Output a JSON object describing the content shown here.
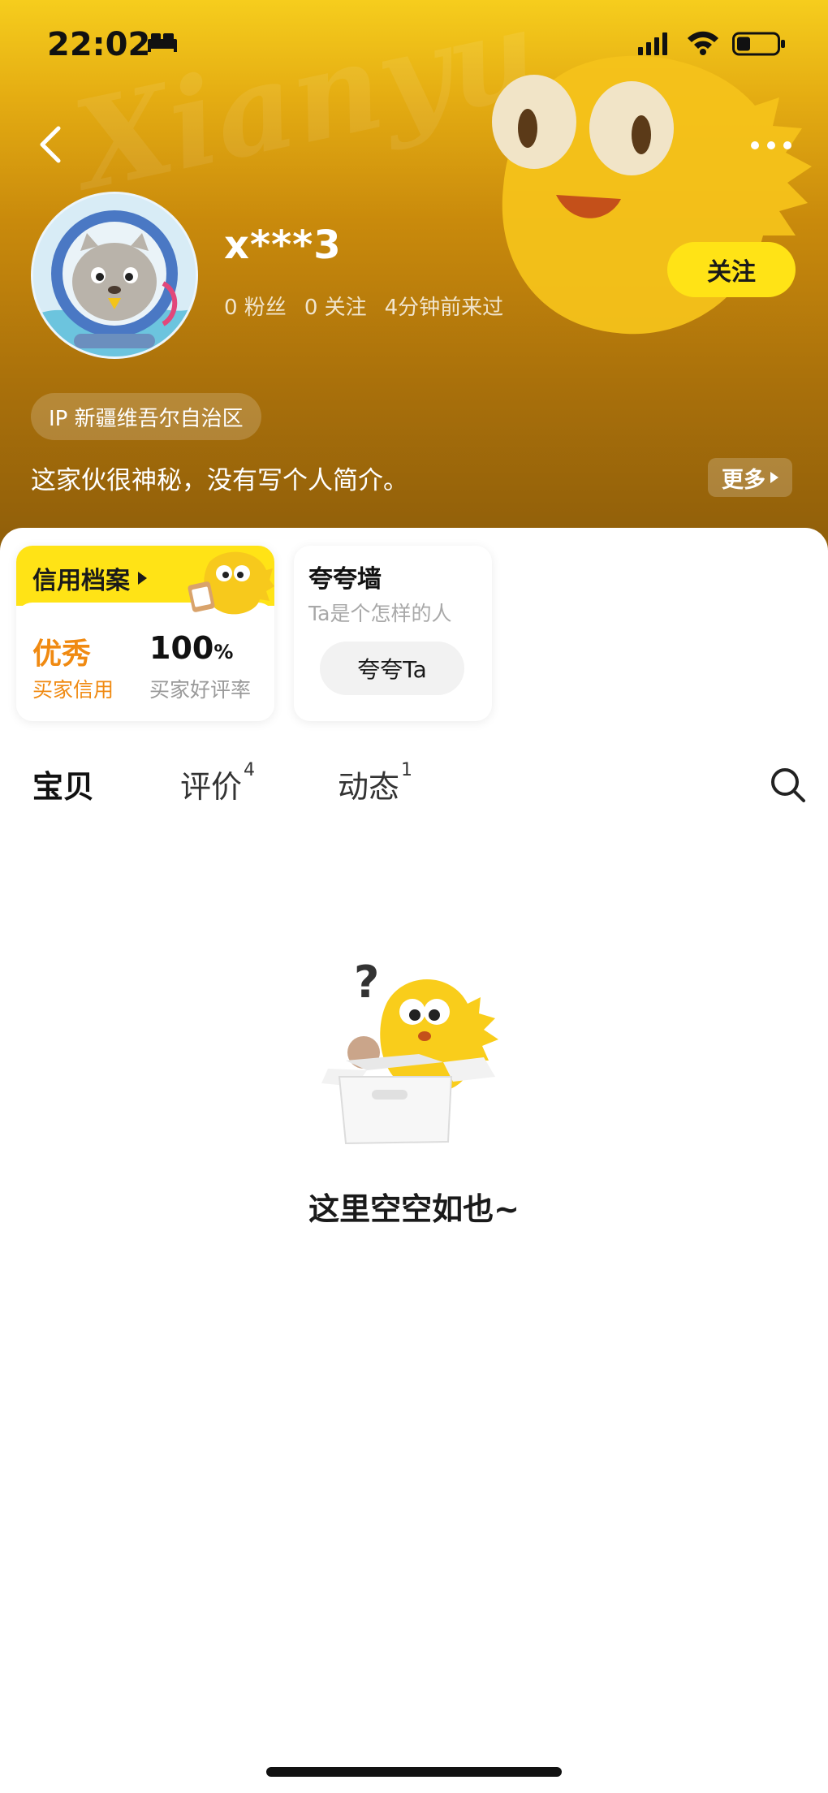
{
  "status_bar": {
    "time": "22:02"
  },
  "profile": {
    "username": "x***3",
    "fans": "0 粉丝",
    "following": "0 关注",
    "last_seen": "4分钟前来过",
    "follow_label": "关注",
    "ip_location": "IP 新疆维吾尔自治区",
    "bio": "这家伙很神秘，没有写个人简介。",
    "more_label": "更多"
  },
  "credit_card": {
    "title": "信用档案",
    "level": "优秀",
    "level_label": "买家信用",
    "rate": "100",
    "rate_unit": "%",
    "rate_label": "买家好评率"
  },
  "praise_card": {
    "title": "夸夸墙",
    "subtitle": "Ta是个怎样的人",
    "button_label": "夸夸Ta"
  },
  "tabs": [
    {
      "label": "宝贝",
      "count": ""
    },
    {
      "label": "评价",
      "count": "4"
    },
    {
      "label": "动态",
      "count": "1"
    }
  ],
  "empty_state": {
    "text": "这里空空如也~"
  },
  "colors": {
    "accent": "#ffe316",
    "credit_orange": "#f08a12",
    "hero_top": "#f6cd1d",
    "hero_bottom": "#8f5e0a"
  }
}
